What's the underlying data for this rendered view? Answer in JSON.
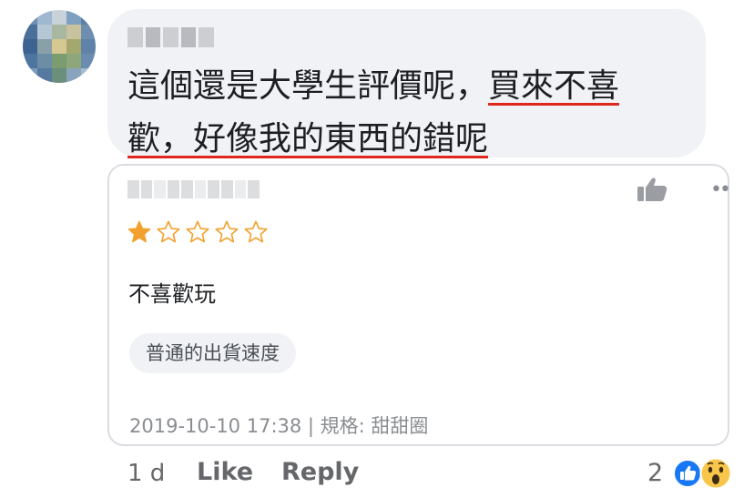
{
  "comment": {
    "line1_a": "這個還是大學生評價呢，",
    "line1_b": "買來不喜",
    "line2_a": "歡",
    "line2_b": "，好像我的東西的錯呢"
  },
  "review": {
    "rating": 1,
    "max_rating": 5,
    "text": "不喜歡玩",
    "tag": "普通的出貨速度",
    "meta": "2019-10-10 17:38 | 規格: 甜甜圈"
  },
  "actions": {
    "time": "1 d",
    "like_label": "Like",
    "reply_label": "Reply",
    "reaction_count": "2"
  },
  "icons": {
    "like": "thumbs-up-icon",
    "more": "more-dots-icon",
    "reactions": [
      "like-reaction-icon",
      "wow-reaction-icon"
    ]
  },
  "colors": {
    "underline": "#e0271d",
    "star": "#f2a12e",
    "like_blue": "#1877f2"
  }
}
